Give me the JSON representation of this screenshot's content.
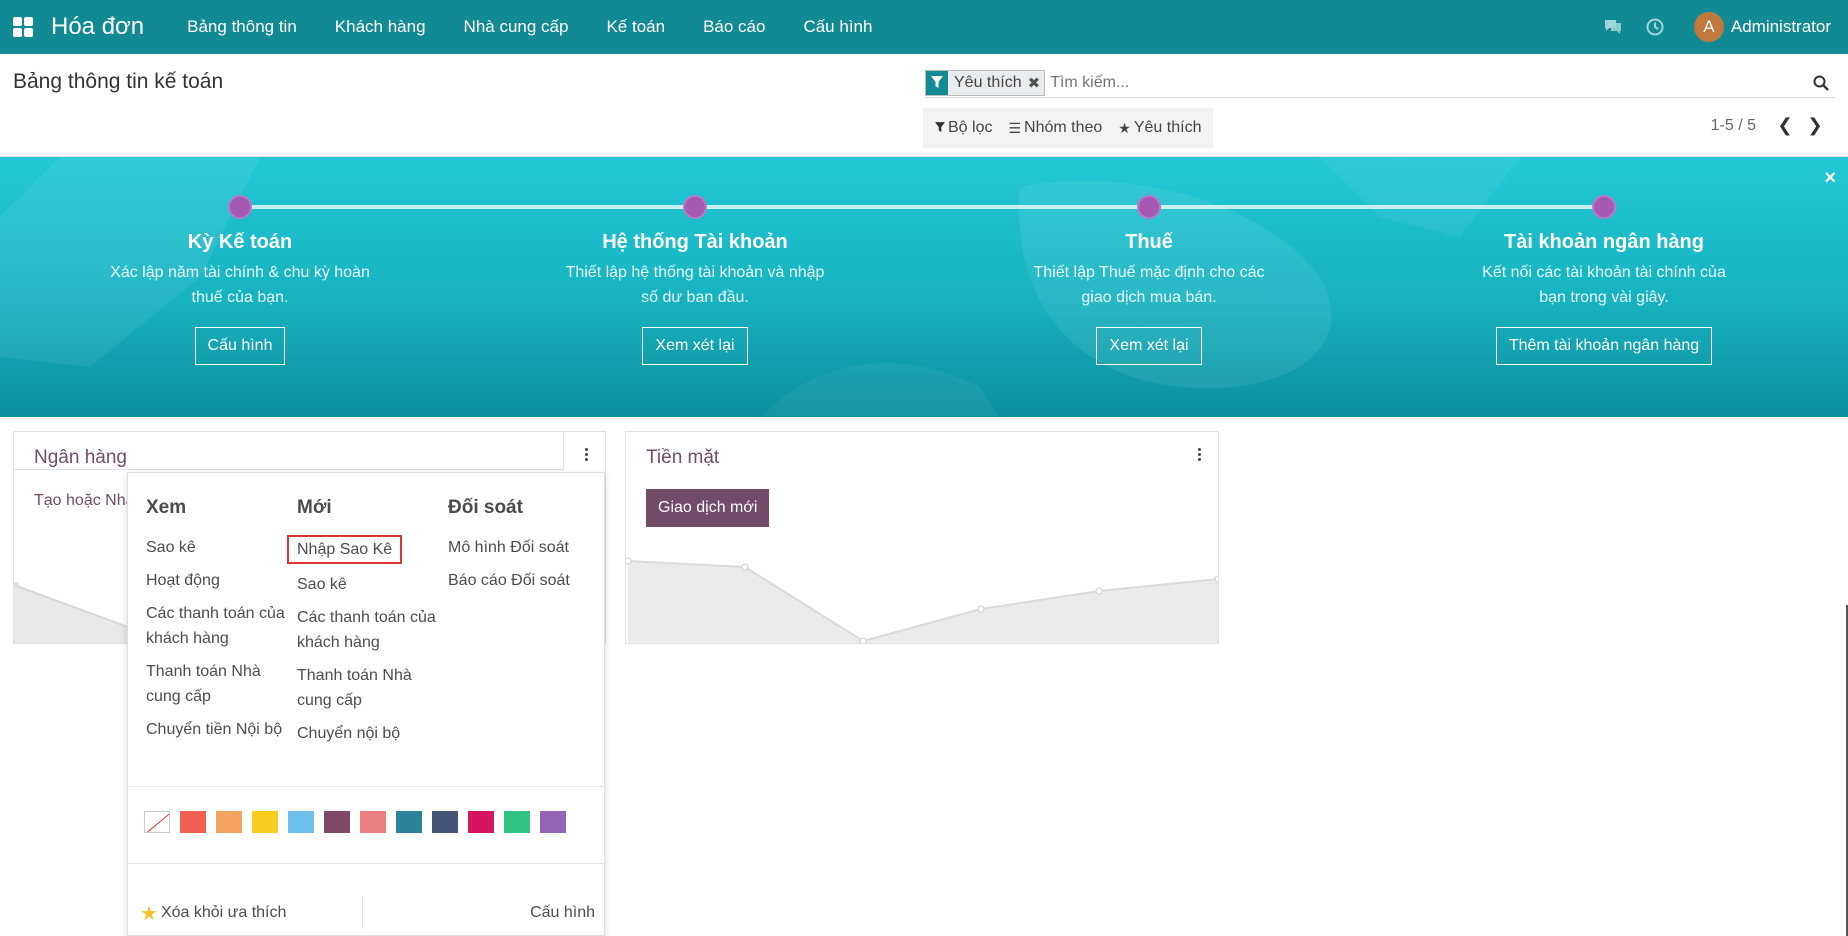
{
  "navbar": {
    "brand": "Hóa đơn",
    "menu": [
      "Bảng thông tin",
      "Khách hàng",
      "Nhà cung cấp",
      "Kế toán",
      "Báo cáo",
      "Cấu hình"
    ],
    "user_initial": "A",
    "user_name": "Administrator"
  },
  "control_panel": {
    "title": "Bảng thông tin kế toán",
    "facet_label": "Yêu thích",
    "search_placeholder": "Tìm kiếm...",
    "filter_label": "Bộ lọc",
    "group_label": "Nhóm theo",
    "favorite_label": "Yêu thích",
    "pager": "1-5 / 5"
  },
  "banner": {
    "close": "×",
    "steps": [
      {
        "title": "Kỳ Kế toán",
        "desc": "Xác lập năm tài chính & chu kỳ hoàn thuế của bạn.",
        "button": "Cấu hình"
      },
      {
        "title": "Hệ thống Tài khoản",
        "desc": "Thiết lập hệ thống tài khoản và nhập số dư ban đầu.",
        "button": "Xem xét lại"
      },
      {
        "title": "Thuế",
        "desc": "Thiết lập Thuế mặc định cho các giao dịch mua bán.",
        "button": "Xem xét lại"
      },
      {
        "title": "Tài khoản ngân hàng",
        "desc": "Kết nối các tài khoản tài chính của bạn trong vài giây.",
        "button": "Thêm tài khoản ngân hàng"
      }
    ]
  },
  "cards": {
    "bank": {
      "title": "Ngân hàng",
      "link": "Tạo hoặc Nhập"
    },
    "cash": {
      "title": "Tiền mặt",
      "button": "Giao dịch mới"
    }
  },
  "dropdown": {
    "view": {
      "header": "Xem",
      "items": [
        "Sao kê",
        "Hoạt động",
        "Các thanh toán của khách hàng",
        "Thanh toán Nhà cung cấp",
        "Chuyển tiền Nội bộ"
      ]
    },
    "new": {
      "header": "Mới",
      "items": [
        "Nhập Sao Kê",
        "Sao kê",
        "Các thanh toán của khách hàng",
        "Thanh toán Nhà cung cấp",
        "Chuyển nội bộ"
      ]
    },
    "reconcile": {
      "header": "Đối soát",
      "items": [
        "Mô hình Đối soát",
        "Báo cáo Đối soát"
      ]
    },
    "colors": [
      "#f06050",
      "#f4a460",
      "#f7cd1f",
      "#6cc1ed",
      "#814968",
      "#eb7e7f",
      "#2c8397",
      "#475577",
      "#d6145f",
      "#30c381",
      "#9365b8"
    ],
    "remove_favorite": "Xóa khỏi ưa thích",
    "config": "Cấu hình"
  },
  "accent_color": "#714b67",
  "navbar_color": "#128a94"
}
